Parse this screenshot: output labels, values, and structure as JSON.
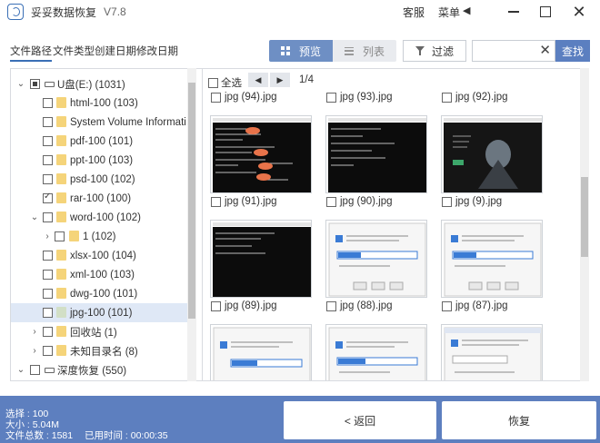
{
  "app": {
    "title": "妥妥数据恢复",
    "version": "V7.8",
    "service": "客服",
    "menu": "菜单",
    "menu_arrow": "◀",
    "close_glyph": "✕"
  },
  "tabs": [
    "文件路径",
    "文件类型",
    "创建日期",
    "修改日期"
  ],
  "view": {
    "preview": "预览",
    "list": "列表"
  },
  "filter_label": "过滤",
  "search": {
    "value": "",
    "placeholder": "",
    "clear": "✕",
    "button": "查找"
  },
  "tree": [
    {
      "label": "U盘(E:)  (1031)"
    },
    {
      "label": "html-100  (103)"
    },
    {
      "label": "System Volume Informati..."
    },
    {
      "label": "pdf-100  (101)"
    },
    {
      "label": "ppt-100  (103)"
    },
    {
      "label": "psd-100  (102)"
    },
    {
      "label": "rar-100  (100)"
    },
    {
      "label": "word-100  (102)"
    },
    {
      "label": "1  (102)"
    },
    {
      "label": "xlsx-100  (104)"
    },
    {
      "label": "xml-100  (103)"
    },
    {
      "label": "dwg-100  (101)"
    },
    {
      "label": "jpg-100  (101)"
    },
    {
      "label": "回收站  (1)"
    },
    {
      "label": "未知目录名  (8)"
    },
    {
      "label": "深度恢复  (550)"
    }
  ],
  "tree_glyphs": {
    "expanded": "⌄",
    "collapsed": "›",
    "expanded_root": "⌄"
  },
  "grid": {
    "select_all": "全选",
    "prev": "◀",
    "next": "▶",
    "page": "1/4",
    "files": [
      {
        "name": "jpg (94).jpg"
      },
      {
        "name": "jpg (93).jpg"
      },
      {
        "name": "jpg (92).jpg"
      },
      {
        "name": "jpg (91).jpg"
      },
      {
        "name": "jpg (90).jpg"
      },
      {
        "name": "jpg (9).jpg"
      },
      {
        "name": "jpg (89).jpg"
      },
      {
        "name": "jpg (88).jpg"
      },
      {
        "name": "jpg (87).jpg"
      }
    ]
  },
  "status": {
    "selected": "选择 : 100",
    "size": "大小 : 5.04M",
    "total": "文件总数 : 1581",
    "elapsed": "已用时间 : 00:00:35"
  },
  "buttons": {
    "back": "< 返回",
    "recover": "恢复"
  },
  "colors": {
    "accent": "#5d7fbf",
    "folder": "#f5d47a"
  }
}
